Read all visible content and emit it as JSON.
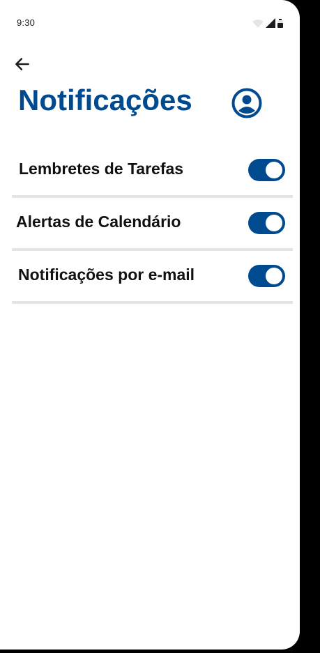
{
  "status_bar": {
    "time": "9:30",
    "icons": [
      "wifi-icon",
      "signal-icon",
      "battery-icon"
    ]
  },
  "header": {
    "back_icon": "arrow-left-icon",
    "title": "Notificações",
    "profile_icon": "account-circle-icon"
  },
  "settings": [
    {
      "label": "Lembretes de Tarefas",
      "enabled": true
    },
    {
      "label": "Alertas de Calendário",
      "enabled": true
    },
    {
      "label": "Notificações por e-mail",
      "enabled": true
    }
  ],
  "colors": {
    "accent": "#004a8f",
    "divider": "#e4e4e4",
    "text": "#111111",
    "background": "#ffffff"
  }
}
